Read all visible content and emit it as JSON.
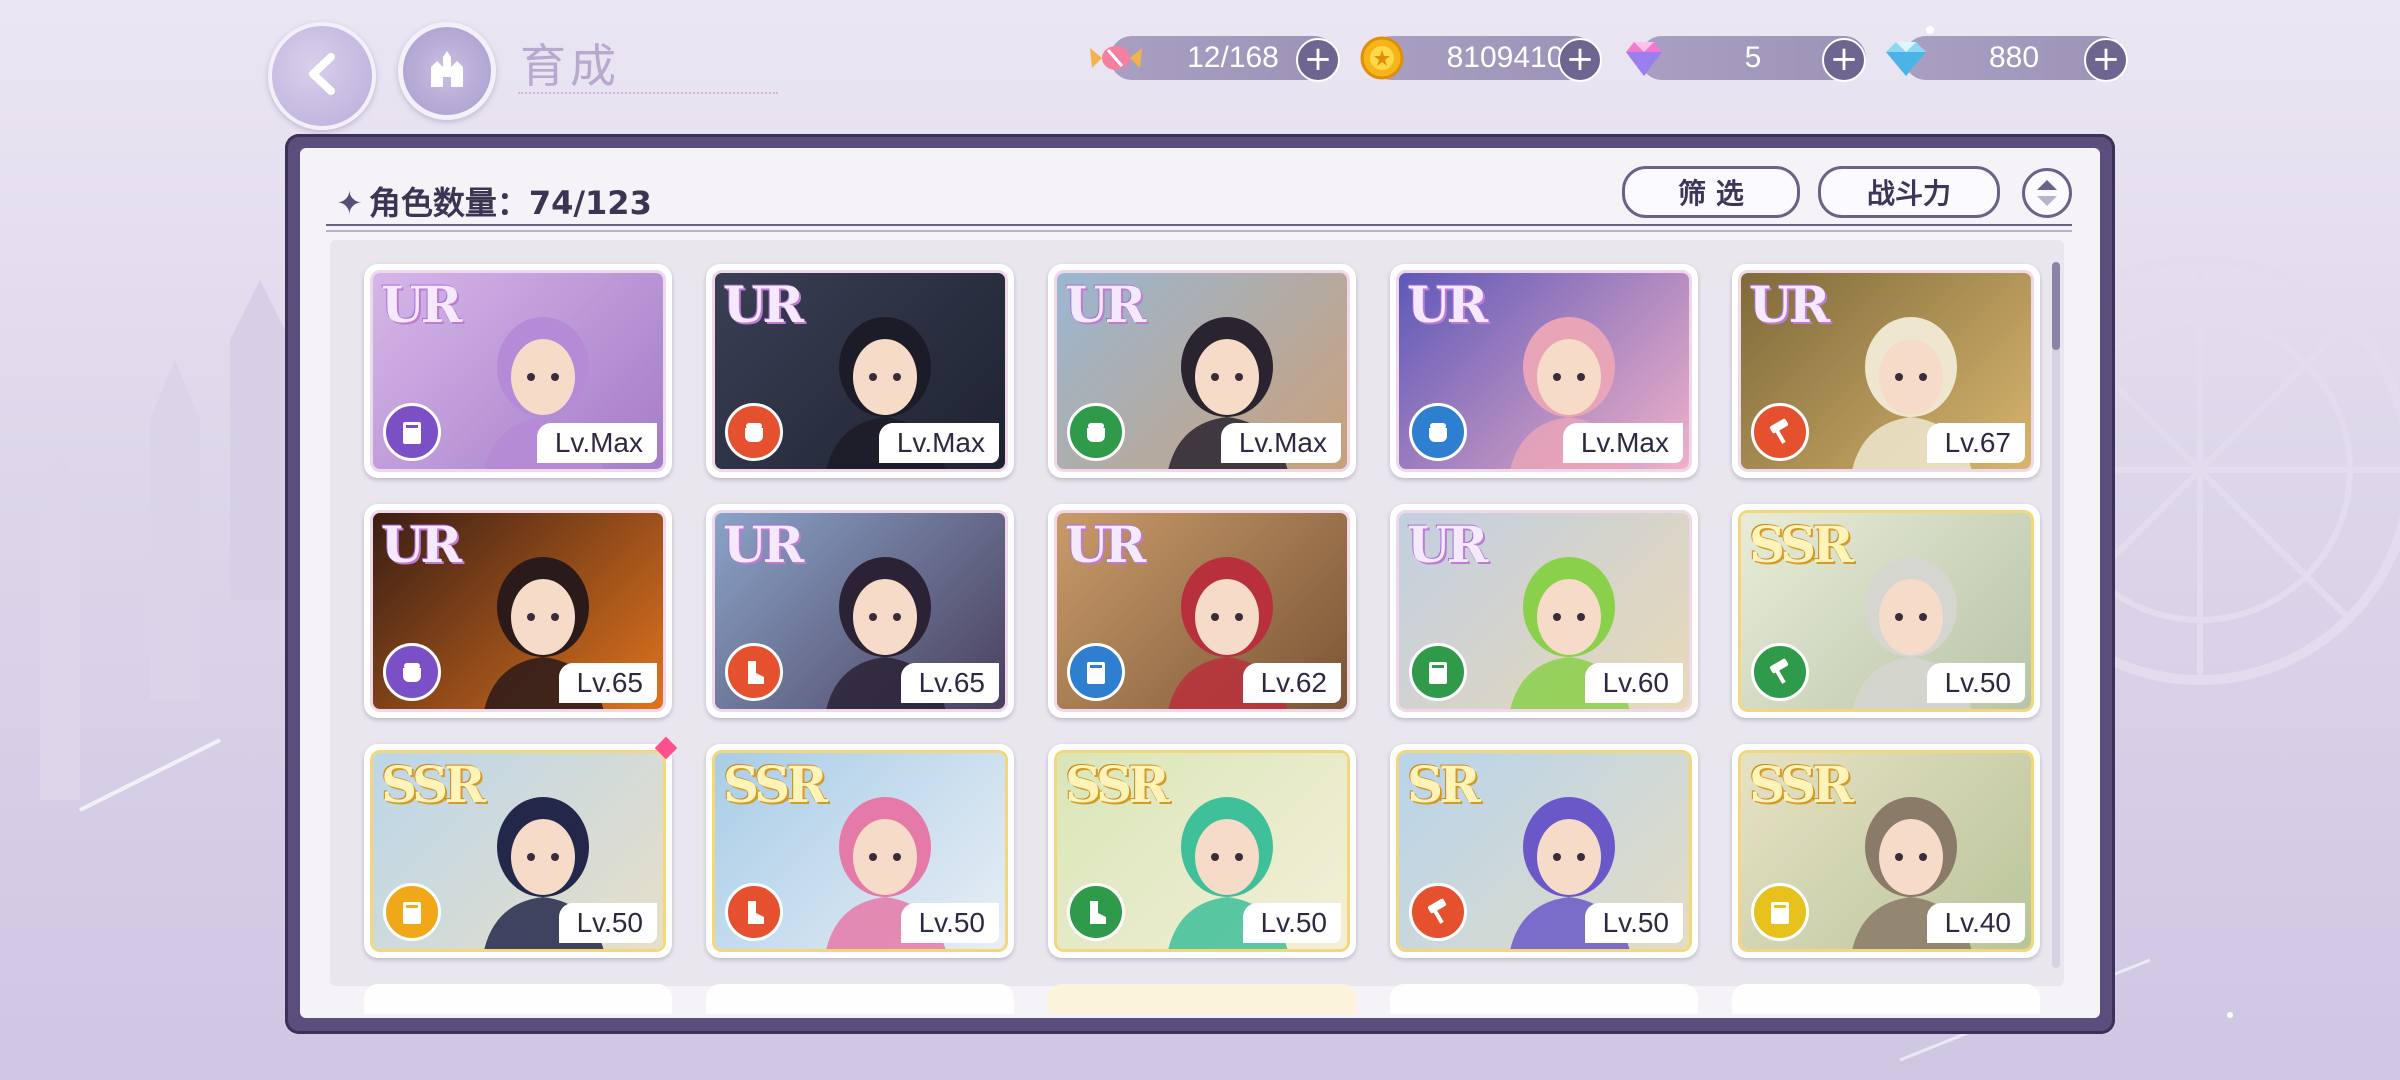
{
  "header": {
    "title": "育成",
    "back_icon": "back-arrow-icon",
    "home_icon": "castle-icon"
  },
  "currencies": [
    {
      "name": "candy",
      "icon": "candy-icon",
      "value": "12/168"
    },
    {
      "name": "coin",
      "icon": "gold-coin-icon",
      "value": "8109410"
    },
    {
      "name": "pink_gem",
      "icon": "pink-gem-icon",
      "value": "5"
    },
    {
      "name": "diamond",
      "icon": "diamond-icon",
      "value": "880"
    }
  ],
  "panel": {
    "count_label": "角色数量：74/123",
    "filter_label": "筛 选",
    "sort_label": "战斗力",
    "sort_icon": "sort-toggle-icon"
  },
  "cards": [
    {
      "rarity": "UR",
      "level": "Lv.Max",
      "type_color": "#7b4fc6",
      "type_icon": "book-icon",
      "hair": "#b58ad6",
      "bg": [
        "#d6b6e8",
        "#a47cc8"
      ]
    },
    {
      "rarity": "UR",
      "level": "Lv.Max",
      "type_color": "#e5502f",
      "type_icon": "fist-icon",
      "hair": "#1c1c28",
      "bg": [
        "#3a3f55",
        "#1e2230"
      ]
    },
    {
      "rarity": "UR",
      "level": "Lv.Max",
      "type_color": "#2f9a4a",
      "type_icon": "fist-icon",
      "hair": "#2a2430",
      "bg": [
        "#9ab7d2",
        "#c9a07a"
      ]
    },
    {
      "rarity": "UR",
      "level": "Lv.Max",
      "type_color": "#2f7fd0",
      "type_icon": "fist-icon",
      "hair": "#e9a5b8",
      "bg": [
        "#5e58b8",
        "#f0b1c8"
      ]
    },
    {
      "rarity": "UR",
      "level": "Lv.67",
      "type_color": "#e5502f",
      "type_icon": "hammer-icon",
      "hair": "#efe6cf",
      "bg": [
        "#7f6a3a",
        "#d7b56e"
      ]
    },
    {
      "rarity": "UR",
      "level": "Lv.65",
      "type_color": "#7b4fc6",
      "type_icon": "fist-icon",
      "hair": "#2a1a1a",
      "bg": [
        "#3a1e14",
        "#e0741e"
      ]
    },
    {
      "rarity": "UR",
      "level": "Lv.65",
      "type_color": "#e5502f",
      "type_icon": "boot-icon",
      "hair": "#2c2236",
      "bg": [
        "#8aa3c8",
        "#4a3f5c"
      ]
    },
    {
      "rarity": "UR",
      "level": "Lv.62",
      "type_color": "#2f7fd0",
      "type_icon": "book-icon",
      "hair": "#b8303c",
      "bg": [
        "#c99b6a",
        "#7a5536"
      ]
    },
    {
      "rarity": "UR",
      "level": "Lv.60",
      "type_color": "#2f9a4a",
      "type_icon": "book-icon",
      "hair": "#8bd04a",
      "bg": [
        "#c2cfe0",
        "#e8d9b8"
      ]
    },
    {
      "rarity": "SSR",
      "level": "Lv.50",
      "type_color": "#2f9a4a",
      "type_icon": "hammer-icon",
      "hair": "#d6d6d0",
      "bg": [
        "#e8ecd8",
        "#b8c4a8"
      ]
    },
    {
      "rarity": "SSR",
      "level": "Lv.50",
      "type_color": "#f0a818",
      "type_icon": "book-icon",
      "hair": "#23284a",
      "bg": [
        "#bcd6ea",
        "#e7dfc8"
      ],
      "new": true
    },
    {
      "rarity": "SSR",
      "level": "Lv.50",
      "type_color": "#e5502f",
      "type_icon": "boot-icon",
      "hair": "#e57aa8",
      "bg": [
        "#a8cde8",
        "#e8eef4"
      ]
    },
    {
      "rarity": "SSR",
      "level": "Lv.50",
      "type_color": "#2f9a4a",
      "type_icon": "boot-icon",
      "hair": "#3fbf9a",
      "bg": [
        "#d9e6b8",
        "#f4efd8"
      ]
    },
    {
      "rarity": "SR",
      "level": "Lv.50",
      "type_color": "#e5502f",
      "type_icon": "hammer-icon",
      "hair": "#6a58c8",
      "bg": [
        "#b8d4ec",
        "#e3dcc4"
      ]
    },
    {
      "rarity": "SSR",
      "level": "Lv.40",
      "type_color": "#e8c21c",
      "type_icon": "book-icon",
      "hair": "#8a7a68",
      "bg": [
        "#e6e2c4",
        "#b9c49a"
      ]
    }
  ]
}
